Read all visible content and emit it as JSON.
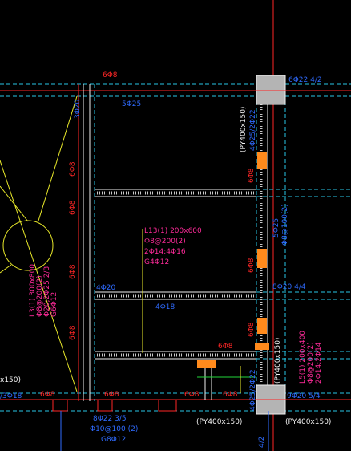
{
  "drawing": {
    "labels": {
      "top_right_rebar": "6Φ22 4/2",
      "top_beam_rebar": "5Φ25",
      "top_stirrup": "6Φ8",
      "left_stirrup_a": "6Φ8",
      "left_stirrup_b": "6Φ8",
      "left_stirrup_c": "6Φ8",
      "left_stirrup_d": "6Φ8",
      "left_top_tag": "3Φ20",
      "beam_l13_name": "L13(1) 200x600",
      "beam_l13_stirrup": "Φ8@200(2)",
      "beam_l13_main": "2Φ14;4Φ16",
      "beam_l13_side": "G4Φ12",
      "mid_rebar_a": "4Φ20",
      "mid_rebar_b": "4Φ18",
      "left_beam_name": "L3(1) 300x800",
      "left_beam_stirrup": "Φ8@200(2)",
      "left_beam_main": "Φ20;2Φ25 2/3",
      "left_beam_side": "G6Φ12",
      "col_pier_top": "(PY400x150)",
      "col_pier_rebar_top": "4Φ25/2Φ22",
      "col_pier_right_upper": "5Φ25",
      "col_pier_right_stirrup": "Φ8@100(2)",
      "right_rebar_mid": "8Φ20 4/4",
      "right_rebar_bottom": "9Φ20 5/4",
      "col_pier_low": "(PY400x150)",
      "col_pier_low_rebar": "4Φ25/2Φ22",
      "beam_l5_name": "L5(1) 200x400",
      "beam_l5_stirrup": "Φ8@200(2)",
      "beam_l5_main": "2Φ14;2Φ14",
      "bottom_stirrup_a": "6Φ8",
      "bottom_stirrup_b": "6Φ8",
      "bottom_stirrup_c": "6Φ8",
      "bottom_stirrup_d": "6Φ8",
      "bottom_stirrup_e": "6Φ8",
      "right_stirrup_mid": "6Φ8",
      "right_stirrup_low": "6Φ8",
      "right_stirrup_bottom": "6Φ8",
      "bottom_beam_main": "8Φ22 3/5",
      "bottom_beam_stirrup": "Φ10@100 (2)",
      "bottom_beam_side": "G8Φ12",
      "bottom_pier_a": "(PY400x150)",
      "bottom_pier_b": "(PY400x150)",
      "left_edge_top": "x150)",
      "left_edge_bottom": "/3Φ18",
      "corner_rebar": "4/2"
    }
  },
  "colors": {
    "background": "#000000",
    "red": "#ff2626",
    "cyan": "#27c6e6",
    "blue": "#2f6bff",
    "yellow": "#e9e92a",
    "magenta": "#ff2b9a",
    "white": "#f0f0f0",
    "orange": "#ff8a1c",
    "grey": "#c8c8c8",
    "green": "#22d63a"
  }
}
